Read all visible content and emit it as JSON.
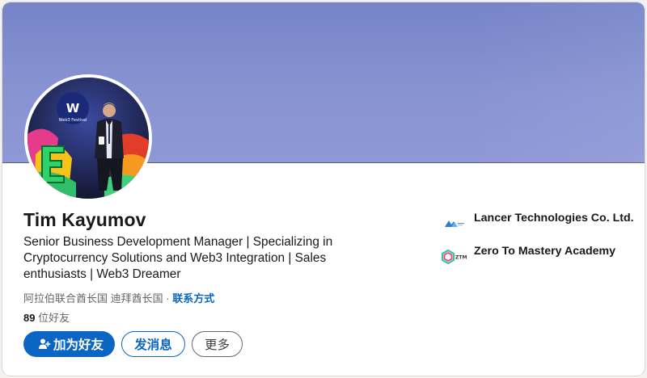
{
  "profile": {
    "name": "Tim Kayumov",
    "headline": "Senior Business Development Manager | Specializing in Cryptocurrency Solutions and Web3 Integration | Sales enthusiasts | Web3 Dreamer",
    "location": "阿拉伯联合酋长国 迪拜酋长国",
    "location_separator": " · ",
    "contact_info_label": "联系方式",
    "connections_count": "89",
    "connections_label": " 位好友"
  },
  "avatar": {
    "badge_text": "Web3 Festival"
  },
  "actions": {
    "connect_label": "加为好友",
    "message_label": "发消息",
    "more_label": "更多"
  },
  "companies": [
    {
      "name": "Lancer Technologies Co. Ltd.",
      "logo": "lancer-logo"
    },
    {
      "name": "Zero To Mastery Academy",
      "logo": "ztm-logo"
    }
  ],
  "colors": {
    "banner": "#7f8ccd",
    "primary": "#0a66c2",
    "text": "#191919",
    "muted": "#666666"
  }
}
